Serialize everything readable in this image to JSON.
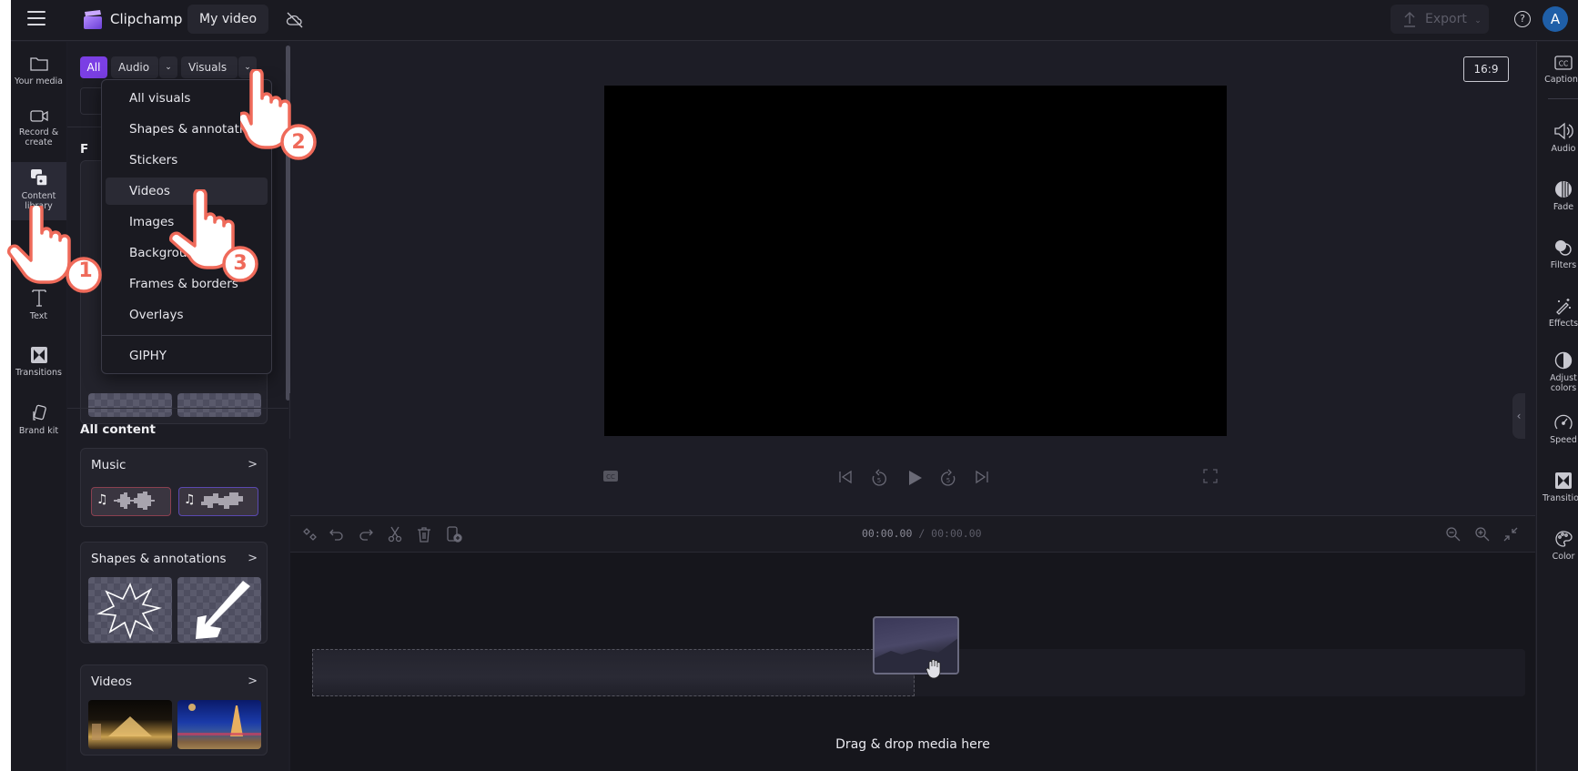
{
  "app": {
    "brand": "Clipchamp",
    "project_title": "My video",
    "export_label": "Export",
    "help_label": "?",
    "avatar_initial": "A",
    "accent_color": "#7b3fe4"
  },
  "left_nav": {
    "items": [
      {
        "label": "Your media",
        "icon": "folder-icon"
      },
      {
        "label": "Record & create",
        "icon": "camera-icon"
      },
      {
        "label": "Content library",
        "icon": "content-library-icon",
        "active": true
      },
      {
        "label": "Text",
        "icon": "text-icon"
      },
      {
        "label": "Transitions",
        "icon": "transitions-icon"
      },
      {
        "label": "Brand kit",
        "icon": "brand-kit-icon"
      }
    ]
  },
  "content_panel": {
    "filters": {
      "all": "All",
      "audio": "Audio",
      "visuals": "Visuals"
    },
    "partial_section_letter": "F",
    "all_content_title": "All content",
    "cards": [
      {
        "title": "Music"
      },
      {
        "title": "Shapes & annotations"
      },
      {
        "title": "Videos"
      }
    ]
  },
  "dropdown": {
    "items": [
      "All visuals",
      "Shapes & annotations",
      "Stickers",
      "Videos",
      "Images",
      "Backgrounds",
      "Frames & borders",
      "Overlays"
    ],
    "hovered": "Videos",
    "footer_item": "GIPHY"
  },
  "preview": {
    "aspect_ratio": "16:9"
  },
  "timeline": {
    "current_time": "00:00.00",
    "separator": " / ",
    "total_time": "00:00.00",
    "drop_message": "Drag & drop media here"
  },
  "right_nav": {
    "items": [
      {
        "label": "Captions",
        "icon": "captions-icon"
      },
      {
        "label": "Audio",
        "icon": "speaker-icon"
      },
      {
        "label": "Fade",
        "icon": "fade-icon"
      },
      {
        "label": "Filters",
        "icon": "filters-icon"
      },
      {
        "label": "Effects",
        "icon": "magic-wand-icon"
      },
      {
        "label": "Adjust colors",
        "icon": "adjust-colors-icon"
      },
      {
        "label": "Speed",
        "icon": "speedometer-icon"
      },
      {
        "label": "Transition",
        "icon": "transition-icon"
      },
      {
        "label": "Color",
        "icon": "palette-icon"
      }
    ]
  },
  "annotations": {
    "steps": [
      "1",
      "2",
      "3"
    ],
    "color": "#ef6a5a"
  }
}
